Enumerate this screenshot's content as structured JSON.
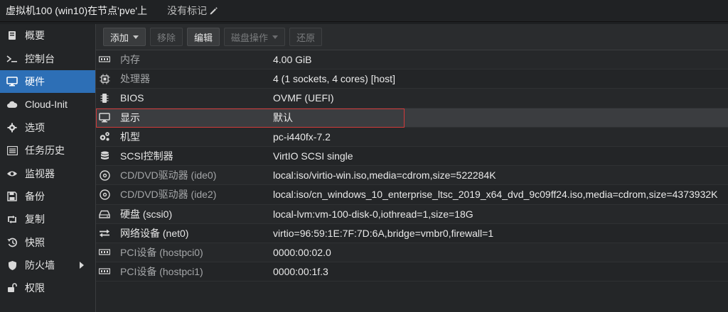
{
  "titlebar": {
    "title": "虚拟机100 (win10)在节点'pve'上",
    "tags_label": "没有标记"
  },
  "sidebar": {
    "items": [
      {
        "label": "概要",
        "icon": "book-icon"
      },
      {
        "label": "控制台",
        "icon": "terminal-icon"
      },
      {
        "label": "硬件",
        "icon": "desktop-icon",
        "active": true
      },
      {
        "label": "Cloud-Init",
        "icon": "cloud-icon"
      },
      {
        "label": "选项",
        "icon": "gear-icon"
      },
      {
        "label": "任务历史",
        "icon": "list-icon"
      },
      {
        "label": "监视器",
        "icon": "eye-icon"
      },
      {
        "label": "备份",
        "icon": "floppy-icon"
      },
      {
        "label": "复制",
        "icon": "retweet-icon"
      },
      {
        "label": "快照",
        "icon": "history-icon"
      },
      {
        "label": "防火墙",
        "icon": "shield-icon",
        "has_submenu": true
      },
      {
        "label": "权限",
        "icon": "unlock-icon"
      }
    ]
  },
  "toolbar": {
    "add_label": "添加",
    "remove_label": "移除",
    "edit_label": "编辑",
    "disk_action_label": "磁盘操作",
    "revert_label": "还原"
  },
  "hardware": {
    "rows": [
      {
        "key": "内存",
        "value": "4.00 GiB",
        "icon": "memory-icon"
      },
      {
        "key": "处理器",
        "value": "4 (1 sockets, 4 cores) [host]",
        "icon": "cpu-icon"
      },
      {
        "key": "BIOS",
        "value": "OVMF (UEFI)",
        "icon": "microchip-icon"
      },
      {
        "key": "显示",
        "value": "默认",
        "icon": "monitor-icon"
      },
      {
        "key": "机型",
        "value": "pc-i440fx-7.2",
        "icon": "cogs-icon"
      },
      {
        "key": "SCSI控制器",
        "value": "VirtIO SCSI single",
        "icon": "database-icon"
      },
      {
        "key": "CD/DVD驱动器 (ide0)",
        "value": "local:iso/virtio-win.iso,media=cdrom,size=522284K",
        "icon": "cdrom-icon"
      },
      {
        "key": "CD/DVD驱动器 (ide2)",
        "value": "local:iso/cn_windows_10_enterprise_ltsc_2019_x64_dvd_9c09ff24.iso,media=cdrom,size=4373932K",
        "icon": "cdrom-icon"
      },
      {
        "key": "硬盘 (scsi0)",
        "value": "local-lvm:vm-100-disk-0,iothread=1,size=18G",
        "icon": "hdd-icon"
      },
      {
        "key": "网络设备 (net0)",
        "value": "virtio=96:59:1E:7F:7D:6A,bridge=vmbr0,firewall=1",
        "icon": "exchange-icon"
      },
      {
        "key": "PCI设备 (hostpci0)",
        "value": "0000:00:02.0",
        "icon": "pci-card-icon"
      },
      {
        "key": "PCI设备 (hostpci1)",
        "value": "0000:00:1f.3",
        "icon": "pci-card-icon"
      }
    ]
  },
  "colors": {
    "active_nav": "#2d6fb6",
    "selection_border": "#d23a3a"
  }
}
